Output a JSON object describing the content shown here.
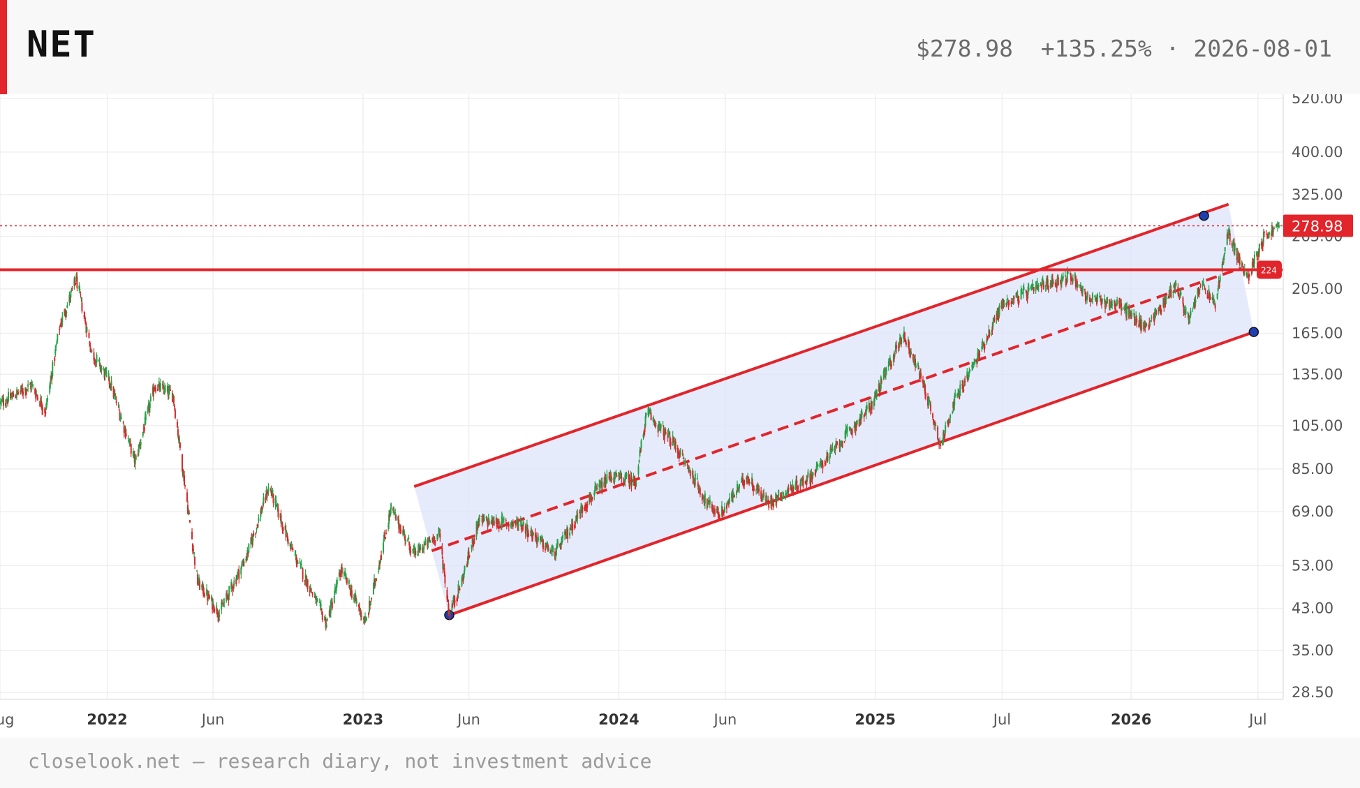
{
  "header": {
    "ticker": "NET",
    "quote": "$278.98  +135.25% · 2026-08-01"
  },
  "footer": {
    "note": "closelook.net — research diary, not investment advice"
  },
  "colors": {
    "accent": "#e1252b",
    "up_candle": "#26a148",
    "down_candle": "#d42a2a",
    "channel_fill": "#dde4fb",
    "channel_line": "#e1252b",
    "anchor_point": "#1f3fb0"
  },
  "chart_data": {
    "type": "candlestick",
    "symbol": "NET",
    "y_scale": "log",
    "ylim": [
      27,
      520
    ],
    "y_ticks": [
      {
        "value": 520,
        "label": "520.00"
      },
      {
        "value": 400,
        "label": "400.00"
      },
      {
        "value": 325,
        "label": "325.00"
      },
      {
        "value": 265,
        "label": "265.00"
      },
      {
        "value": 205,
        "label": "205.00"
      },
      {
        "value": 165,
        "label": "165.00"
      },
      {
        "value": 135,
        "label": "135.00"
      },
      {
        "value": 105,
        "label": "105.00"
      },
      {
        "value": 85,
        "label": "85.00"
      },
      {
        "value": 69,
        "label": "69.00"
      },
      {
        "value": 53,
        "label": "53.00"
      },
      {
        "value": 43,
        "label": "43.00"
      },
      {
        "value": 35,
        "label": "35.00"
      },
      {
        "value": 28.5,
        "label": "28.50"
      }
    ],
    "xlim": [
      "2021-08-01",
      "2026-08-06"
    ],
    "x_ticks": [
      {
        "date": "2021-08-01",
        "label": "Aug",
        "bold": false
      },
      {
        "date": "2022-01-01",
        "label": "2022",
        "bold": true
      },
      {
        "date": "2022-06-01",
        "label": "Jun",
        "bold": false
      },
      {
        "date": "2023-01-01",
        "label": "2023",
        "bold": true
      },
      {
        "date": "2023-06-01",
        "label": "Jun",
        "bold": false
      },
      {
        "date": "2024-01-01",
        "label": "2024",
        "bold": true
      },
      {
        "date": "2024-06-01",
        "label": "Jun",
        "bold": false
      },
      {
        "date": "2025-01-01",
        "label": "2025",
        "bold": true
      },
      {
        "date": "2025-07-01",
        "label": "Jul",
        "bold": false
      },
      {
        "date": "2026-01-01",
        "label": "2026",
        "bold": true
      },
      {
        "date": "2026-07-01",
        "label": "Jul",
        "bold": false
      }
    ],
    "price_path": [
      [
        "2021-08-01",
        117
      ],
      [
        "2021-09-15",
        128
      ],
      [
        "2021-10-05",
        113
      ],
      [
        "2021-10-25",
        170
      ],
      [
        "2021-11-18",
        215
      ],
      [
        "2021-12-10",
        150
      ],
      [
        "2022-01-05",
        130
      ],
      [
        "2022-02-10",
        88
      ],
      [
        "2022-03-10",
        128
      ],
      [
        "2022-04-05",
        122
      ],
      [
        "2022-05-10",
        49
      ],
      [
        "2022-06-10",
        42
      ],
      [
        "2022-07-20",
        56
      ],
      [
        "2022-08-20",
        78
      ],
      [
        "2022-09-20",
        58
      ],
      [
        "2022-11-10",
        40
      ],
      [
        "2022-12-01",
        52
      ],
      [
        "2023-01-05",
        40
      ],
      [
        "2023-02-10",
        70
      ],
      [
        "2023-03-15",
        56
      ],
      [
        "2023-04-20",
        62
      ],
      [
        "2023-05-04",
        42
      ],
      [
        "2023-05-20",
        48
      ],
      [
        "2023-06-15",
        66
      ],
      [
        "2023-08-15",
        65
      ],
      [
        "2023-10-01",
        56
      ],
      [
        "2023-11-15",
        72
      ],
      [
        "2023-12-20",
        82
      ],
      [
        "2024-01-25",
        80
      ],
      [
        "2024-02-10",
        112
      ],
      [
        "2024-03-20",
        96
      ],
      [
        "2024-04-20",
        80
      ],
      [
        "2024-05-05",
        72
      ],
      [
        "2024-05-25",
        68
      ],
      [
        "2024-07-01",
        82
      ],
      [
        "2024-08-01",
        72
      ],
      [
        "2024-10-01",
        82
      ],
      [
        "2024-11-20",
        100
      ],
      [
        "2024-12-25",
        115
      ],
      [
        "2025-02-10",
        165
      ],
      [
        "2025-03-10",
        130
      ],
      [
        "2025-04-05",
        95
      ],
      [
        "2025-04-20",
        115
      ],
      [
        "2025-05-25",
        145
      ],
      [
        "2025-07-01",
        190
      ],
      [
        "2025-09-01",
        210
      ],
      [
        "2025-10-10",
        218
      ],
      [
        "2025-11-01",
        195
      ],
      [
        "2025-12-15",
        190
      ],
      [
        "2026-01-20",
        170
      ],
      [
        "2026-02-10",
        185
      ],
      [
        "2026-03-05",
        210
      ],
      [
        "2026-03-25",
        175
      ],
      [
        "2026-04-10",
        210
      ],
      [
        "2026-05-01",
        190
      ],
      [
        "2026-05-20",
        270
      ],
      [
        "2026-06-15",
        215
      ],
      [
        "2026-07-10",
        265
      ],
      [
        "2026-08-01",
        278.98
      ]
    ],
    "last_price": 278.98,
    "last_price_label": "278.98",
    "horizontal_level": {
      "price": 225,
      "label": "224"
    },
    "parallel_channel": {
      "lower_start": {
        "date": "2023-05-04",
        "price": 41.6
      },
      "lower_end": {
        "date": "2026-06-25",
        "price": 166
      },
      "upper_start": {
        "date": "2023-03-15",
        "price": 78
      },
      "upper_end": {
        "date": "2026-05-20",
        "price": 310
      },
      "anchor_points": [
        {
          "date": "2023-05-04",
          "price": 41.6
        },
        {
          "date": "2026-04-15",
          "price": 293
        },
        {
          "date": "2026-06-25",
          "price": 166
        }
      ]
    },
    "grid": true,
    "title": "",
    "xlabel": "",
    "ylabel": ""
  }
}
